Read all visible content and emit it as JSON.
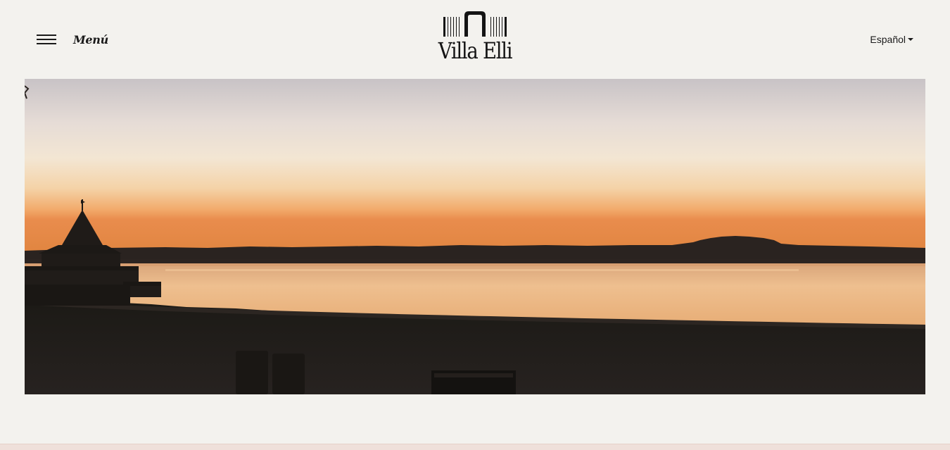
{
  "header": {
    "menu_label": "Menú",
    "logo_text": "Villa Elli",
    "language": "Español"
  },
  "hero": {
    "description": "sunset over lake with gazebo silhouette",
    "colors": {
      "sky_top": "#c9c4c6",
      "sky_mid": "#f1e0c9",
      "horizon": "#f0a26a",
      "water": "#e8b282",
      "ground": "#1b1713"
    }
  },
  "colors": {
    "background": "#f3f2ee",
    "text": "#1a1a1a",
    "footer_strip": "#efe0da"
  }
}
